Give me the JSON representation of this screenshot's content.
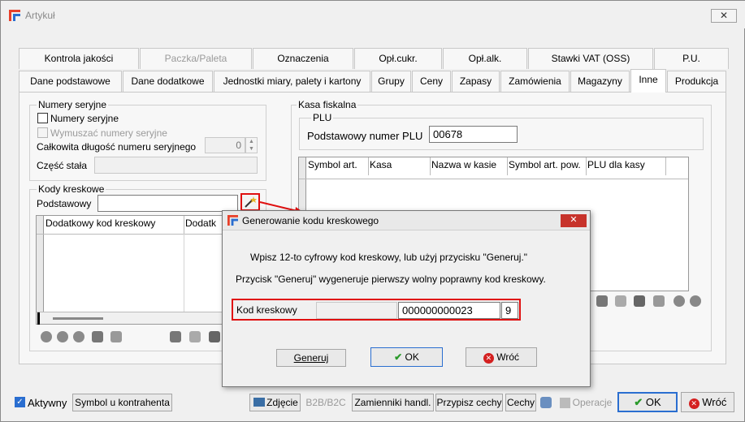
{
  "window": {
    "title": "Artykuł",
    "close_glyph": "✕"
  },
  "tabs_row1": [
    {
      "label": "Kontrola jakości",
      "disabled": false
    },
    {
      "label": "Paczka/Paleta",
      "disabled": true
    },
    {
      "label": "Oznaczenia",
      "disabled": false
    },
    {
      "label": "Opł.cukr.",
      "disabled": false
    },
    {
      "label": "Opł.alk.",
      "disabled": false
    },
    {
      "label": "Stawki VAT (OSS)",
      "disabled": false
    },
    {
      "label": "P.U.",
      "disabled": false
    }
  ],
  "tabs_row2": [
    {
      "label": "Dane podstawowe"
    },
    {
      "label": "Dane dodatkowe"
    },
    {
      "label": "Jednostki miary, palety i kartony"
    },
    {
      "label": "Grupy"
    },
    {
      "label": "Ceny"
    },
    {
      "label": "Zapasy"
    },
    {
      "label": "Zamówienia"
    },
    {
      "label": "Magazyny"
    },
    {
      "label": "Inne"
    },
    {
      "label": "Produkcja"
    }
  ],
  "serial": {
    "group_label": "Numery seryjne",
    "serial_numbers_label": "Numery seryjne",
    "force_label": "Wymuszać numery seryjne",
    "total_length_label": "Całkowita długość numeru seryjnego",
    "total_length_value": "0",
    "fixed_part_label": "Część stała"
  },
  "barcodes": {
    "group_label": "Kody kreskowe",
    "primary_label": "Podstawowy",
    "columns": [
      "Dodatkowy kod kreskowy",
      "Dodatk"
    ]
  },
  "fiscal": {
    "group_label": "Kasa fiskalna",
    "plu_group_label": "PLU",
    "plu_label": "Podstawowy numer PLU",
    "plu_value": "00678",
    "columns": [
      "Symbol art.",
      "Kasa",
      "Nazwa w kasie",
      "Symbol art. pow.",
      "PLU dla kasy"
    ]
  },
  "dialog": {
    "title": "Generowanie kodu kreskowego",
    "line1": "Wpisz 12-to cyfrowy kod kreskowy, lub użyj przycisku \"Generuj.\"",
    "line2": "Przycisk \"Generuj\" wygeneruje pierwszy wolny poprawny kod kreskowy.",
    "barcode_label": "Kod kreskowy",
    "barcode_value": "000000000023",
    "check_digit": "9",
    "generate_label": "Generuj",
    "ok_label": "OK",
    "back_label": "Wróć"
  },
  "footer": {
    "active_label": "Aktywny",
    "symbol_contractor": "Symbol u kontrahenta",
    "photo": "Zdjęcie",
    "b2b": "B2B/B2C",
    "substitutes": "Zamienniki handl.",
    "assign_features": "Przypisz cechy",
    "features": "Cechy",
    "operations": "Operacje",
    "ok": "OK",
    "back": "Wróć"
  },
  "colors": {
    "accent_red": "#e01010",
    "ok_green": "#2a9a2a",
    "cancel_red": "#d42020",
    "title_red": "#c0392b"
  }
}
